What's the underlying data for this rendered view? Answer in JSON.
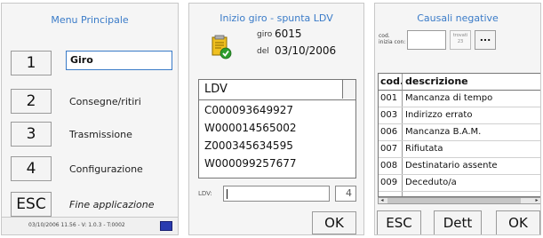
{
  "screen1": {
    "title": "Menu Principale",
    "items": [
      {
        "key": "1",
        "label": "Giro"
      },
      {
        "key": "2",
        "label": "Consegne/ritiri"
      },
      {
        "key": "3",
        "label": "Trasmissione"
      },
      {
        "key": "4",
        "label": "Configurazione"
      },
      {
        "key": "ESC",
        "label": "Fine applicazione"
      }
    ],
    "status_text": "03/10/2006 11.56 - V: 1.0.3 - T:0002"
  },
  "screen2": {
    "title": "Inizio giro - spunta LDV",
    "giro_label": "giro",
    "giro_value": "6015",
    "del_label": "del",
    "del_value": "03/10/2006",
    "list_header": "LDV",
    "list_items": [
      "C000093649927",
      "W000014565002",
      "Z000345634595",
      "W000099257677"
    ],
    "ldv_label": "LDV:",
    "ldv_value": "",
    "count": "4",
    "ok_label": "OK"
  },
  "screen3": {
    "title": "Causali negative",
    "cod_label_line1": "cod.",
    "cod_label_line2": "inizia con:",
    "cod_value": "",
    "trovati_label": "trovati",
    "trovati_value": "23",
    "ellipsis_label": "...",
    "columns": [
      "cod.",
      "descrizione"
    ],
    "rows": [
      {
        "cod": "001",
        "desc": "Mancanza di tempo"
      },
      {
        "cod": "003",
        "desc": "Indirizzo errato"
      },
      {
        "cod": "006",
        "desc": "Mancanza B.A.M."
      },
      {
        "cod": "007",
        "desc": "Rifiutata"
      },
      {
        "cod": "008",
        "desc": "Destinatario assente"
      },
      {
        "cod": "009",
        "desc": "Deceduto/a"
      }
    ],
    "esc_label": "ESC",
    "dett_label": "Dett",
    "ok_label": "OK"
  },
  "colors": {
    "title_blue": "#3a7bc8",
    "status_indicator": "#2a3cb0",
    "icon_check": "#2e9d2e",
    "icon_doc": "#f0c020"
  }
}
